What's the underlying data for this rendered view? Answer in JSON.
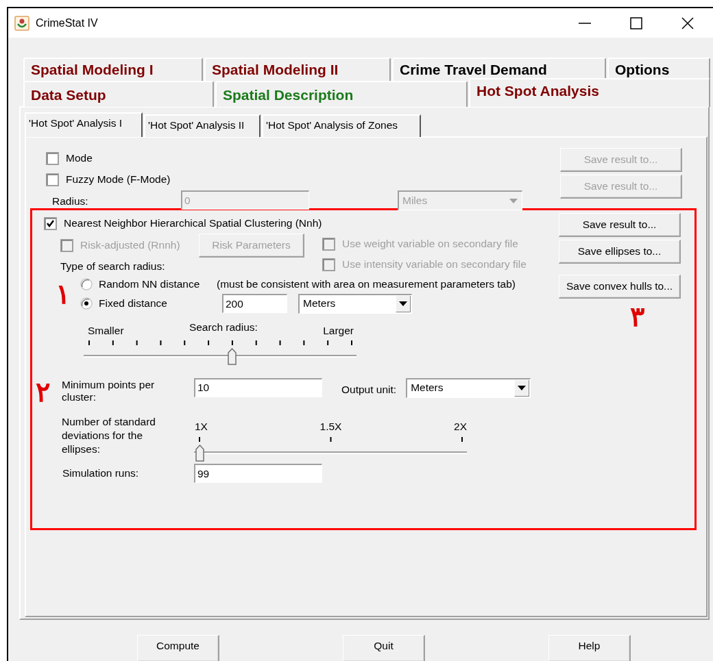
{
  "window": {
    "title": "CrimeStat IV"
  },
  "main_tab_rows": [
    {
      "tabs": [
        {
          "label": "Spatial Modeling I",
          "selected": false,
          "color": "#800000"
        },
        {
          "label": "Spatial Modeling II",
          "selected": false,
          "color": "#800000"
        },
        {
          "label": "Crime Travel Demand",
          "selected": false,
          "color": "#000000"
        },
        {
          "label": "Options",
          "selected": false,
          "color": "#000000"
        }
      ]
    },
    {
      "tabs": [
        {
          "label": "Data Setup",
          "selected": false,
          "color": "#800000"
        },
        {
          "label": "Spatial Description",
          "selected": false,
          "color": "#1a7a1a"
        },
        {
          "label": "Hot Spot Analysis",
          "selected": true,
          "color": "#800000"
        }
      ]
    }
  ],
  "sub_tabs": [
    {
      "label": "'Hot Spot' Analysis I",
      "selected": true
    },
    {
      "label": "'Hot Spot' Analysis II",
      "selected": false
    },
    {
      "label": "'Hot Spot' Analysis of Zones",
      "selected": false
    }
  ],
  "top_options": {
    "checkboxes": [
      {
        "label": "Mode",
        "checked": false
      },
      {
        "label": "Fuzzy Mode (F-Mode)",
        "checked": false
      }
    ],
    "radius": {
      "label": "Radius:",
      "value": "0",
      "disabled": true
    },
    "radius_unit": {
      "value": "Miles",
      "disabled": true
    },
    "buttons": [
      {
        "label": "Save result to...",
        "disabled": true
      },
      {
        "label": "Save result to...",
        "disabled": true
      }
    ]
  },
  "nnh": {
    "label": "Nearest Neighbor Hierarchical Spatial Clustering (Nnh)",
    "checked": true,
    "risk_adjusted": {
      "label": "Risk-adjusted (Rnnh)",
      "checked": false,
      "disabled": true
    },
    "risk_parameters_button": {
      "label": "Risk Parameters",
      "disabled": true
    },
    "secondary_options": [
      {
        "label": "Use weight variable on secondary file",
        "checked": false,
        "disabled": true
      },
      {
        "label": "Use intensity variable on secondary file",
        "checked": false,
        "disabled": true
      }
    ],
    "search_radius_type_label": "Type of search radius:",
    "search_radius_options": [
      {
        "label": "Random NN distance",
        "selected": false,
        "note": "(must be consistent with area on measurement parameters tab)"
      },
      {
        "label": "Fixed distance",
        "selected": true
      }
    ],
    "fixed_distance": {
      "value": "200",
      "unit": "Meters"
    },
    "search_radius_slider": {
      "label": "Search radius:",
      "min_label": "Smaller",
      "max_label": "Larger",
      "level": 0.545
    },
    "min_points": {
      "label": "Minimum points per cluster:",
      "value": "10"
    },
    "output_unit": {
      "label": "Output unit:",
      "value": "Meters"
    },
    "std_dev_slider": {
      "label": "Number of standard deviations for the ellipses:",
      "tick_labels": [
        "1X",
        "1.5X",
        "2X"
      ],
      "level": 0
    },
    "simulation_runs": {
      "label": "Simulation runs:",
      "value": "99"
    },
    "buttons": [
      {
        "label": "Save result to...",
        "disabled": false
      },
      {
        "label": "Save ellipses to...",
        "disabled": false
      },
      {
        "label": "Save convex hulls to...",
        "disabled": false
      }
    ]
  },
  "annotations": [
    {
      "label": "۱"
    },
    {
      "label": "۲"
    },
    {
      "label": "۳"
    }
  ],
  "footer_buttons": [
    {
      "label": "Compute"
    },
    {
      "label": "Quit"
    },
    {
      "label": "Help"
    }
  ]
}
